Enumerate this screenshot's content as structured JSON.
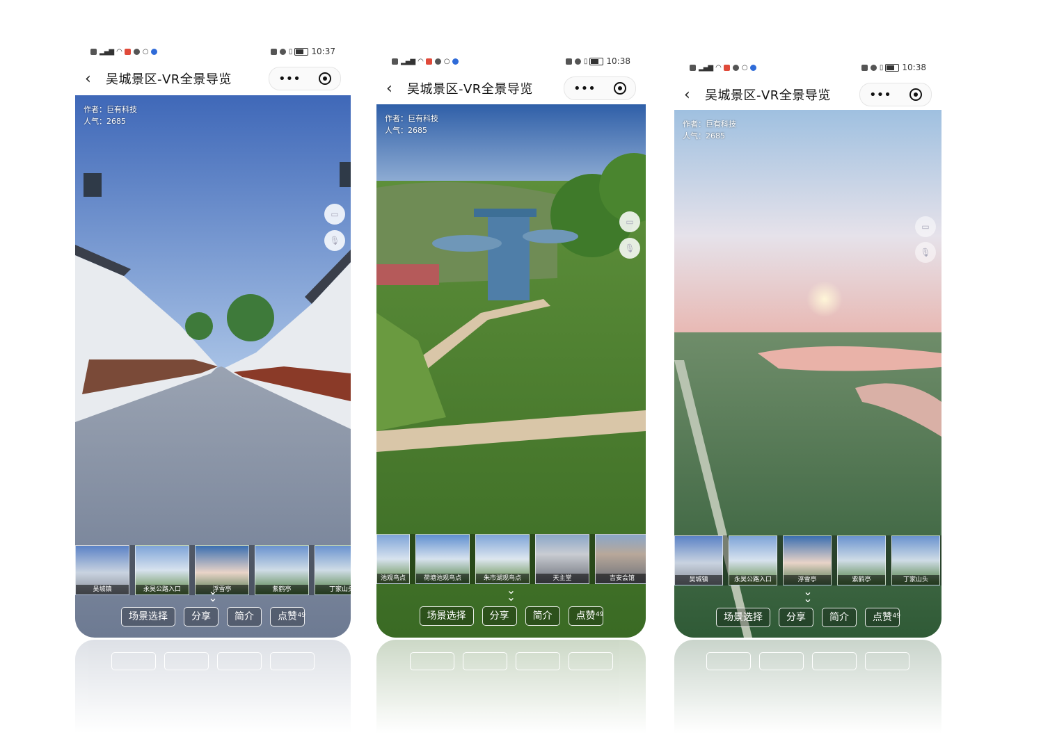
{
  "status_bar": {
    "left_icons": [
      "nfc-icon",
      "signal-icon",
      "wifi-icon",
      "app-badge-icon",
      "chat-icon",
      "search-icon",
      "notification-icon"
    ],
    "right_icons": [
      "nfc-icon",
      "alarm-icon",
      "vibrate-icon",
      "battery-icon"
    ]
  },
  "phones": [
    {
      "time": "10:37",
      "title": "吴城景区-VR全景导览",
      "author": "作者：巨有科技",
      "popularity": "人气：2685",
      "thumbs": [
        "吴城镇",
        "永昊公路入口",
        "浮雪亭",
        "紫鹤亭",
        "丁家山头"
      ],
      "buttons": {
        "scene": "场景选择",
        "share": "分享",
        "intro": "简介",
        "like": "点赞",
        "like_count": "49"
      }
    },
    {
      "time": "10:38",
      "title": "吴城景区-VR全景导览",
      "author": "作者：巨有科技",
      "popularity": "人气：2685",
      "thumbs": [
        "池观鸟点",
        "荷塘池观鸟点",
        "朱市湖观鸟点",
        "天主堂",
        "吉安会馆"
      ],
      "buttons": {
        "scene": "场景选择",
        "share": "分享",
        "intro": "简介",
        "like": "点赞",
        "like_count": "49"
      }
    },
    {
      "time": "10:38",
      "title": "吴城景区-VR全景导览",
      "author": "作者：巨有科技",
      "popularity": "人气：2685",
      "thumbs": [
        "吴城镇",
        "永昊公路入口",
        "浮雪亭",
        "紫鹤亭",
        "丁家山头"
      ],
      "buttons": {
        "scene": "场景选择",
        "share": "分享",
        "intro": "简介",
        "like": "点赞",
        "like_count": "49"
      }
    }
  ],
  "colors": {
    "sky_street": "#4f78c2",
    "ground_street": "#7d8aa0",
    "sky_park": "#8fb0d8",
    "grass_park": "#3d7a2a",
    "sunset_sky": "#d9e2f0",
    "sunset_pink": "#e8b3b0",
    "wetland": "#3f6a45"
  }
}
